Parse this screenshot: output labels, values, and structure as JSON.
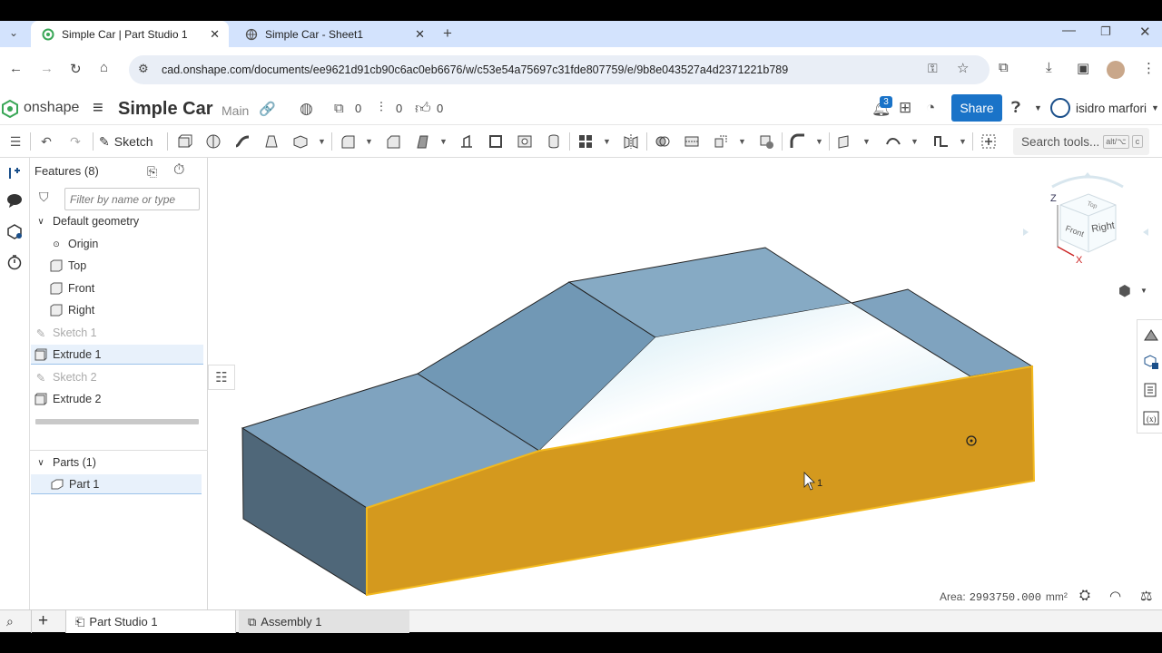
{
  "browser": {
    "tabs": [
      {
        "title": "Simple Car | Part Studio 1",
        "active": true
      },
      {
        "title": "Simple Car - Sheet1",
        "active": false
      }
    ],
    "url": "cad.onshape.com/documents/ee9621d91cb90c6ac0eb6676/w/c53e54a75697c31fde807759/e/9b8e043527a4d2371221b789"
  },
  "header": {
    "logo_text": "onshape",
    "doc_title": "Simple Car",
    "branch": "Main",
    "versions_count": "0",
    "branches_count": "0",
    "likes_count": "0",
    "notif_count": "3",
    "share_label": "Share",
    "user_name": "isidro marfori"
  },
  "toolbar": {
    "sketch_label": "Sketch",
    "search_placeholder": "Search tools...",
    "search_shortcut": "alt/⌥",
    "search_shortcut2": "c"
  },
  "features": {
    "title": "Features (8)",
    "filter_placeholder": "Filter by name or type",
    "group_label": "Default geometry",
    "items": [
      {
        "label": "Origin"
      },
      {
        "label": "Top"
      },
      {
        "label": "Front"
      },
      {
        "label": "Right"
      },
      {
        "label": "Sketch 1"
      },
      {
        "label": "Extrude 1"
      },
      {
        "label": "Sketch 2"
      },
      {
        "label": "Extrude 2"
      }
    ],
    "parts_label": "Parts (1)",
    "part_item": "Part 1"
  },
  "viewcube": {
    "z": "Z",
    "x": "X",
    "front": "Front",
    "right": "Right",
    "top": "Top"
  },
  "status": {
    "area_label": "Area:",
    "area_value": "2993750.000",
    "area_unit": "mm²"
  },
  "cursor_label": "1",
  "bottom_tabs": [
    {
      "label": "Part Studio 1"
    },
    {
      "label": "Assembly 1"
    }
  ],
  "colors": {
    "selected_face": "#d4991e",
    "face_blue": "#7fa3bf",
    "accent": "#1a73c8"
  }
}
